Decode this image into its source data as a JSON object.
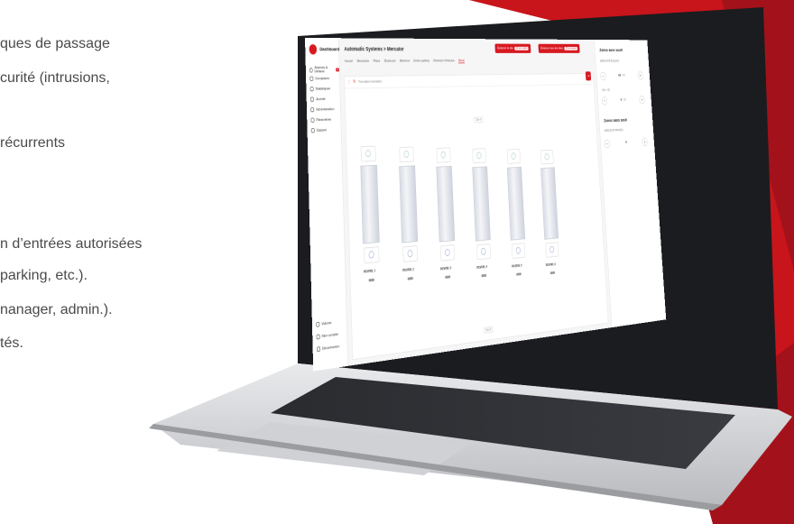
{
  "left_text": {
    "lines": [
      "ques de passage",
      "curité  (intrusions,",
      " récurrents",
      "n d’entrées autorisées",
      " parking, etc.).",
      "nanager, admin.).",
      "tés."
    ]
  },
  "colors": {
    "brand": "#d71920",
    "accent_dark": "#a3121a"
  },
  "app": {
    "sidebar": {
      "title": "Dashboard",
      "items": [
        {
          "label": "Alarmes & Défauts",
          "badge": "3",
          "icon": "bell-icon"
        },
        {
          "label": "Compteurs",
          "icon": "counter-icon"
        },
        {
          "label": "Statistiques",
          "icon": "chart-icon"
        },
        {
          "label": "Journal",
          "icon": "journal-icon"
        },
        {
          "label": "Administration",
          "icon": "admin-icon"
        },
        {
          "label": "Paramètres",
          "icon": "gear-icon"
        },
        {
          "label": "Support",
          "icon": "support-icon"
        }
      ],
      "bottom": [
        {
          "label": "Volume",
          "icon": "volume-icon"
        },
        {
          "label": "Mon compte",
          "icon": "user-icon"
        },
        {
          "label": "Déconnexion",
          "icon": "logout-icon"
        }
      ]
    },
    "breadcrumb": "Automatic Systems > Mercator",
    "tabs": [
      "Accueil",
      "Mezzanine",
      "Pistes",
      "Showroom",
      "Barrières",
      "Entrée parking",
      "Showroom FirstLane",
      "Démo"
    ],
    "active_tab": "Démo",
    "actions": [
      {
        "label": "Évacuer le site",
        "count": "10 en cours"
      },
      {
        "label": "Évacuer tous les sites",
        "count": "10 en cours"
      }
    ],
    "panel": {
      "toolbar_label": "Formulaire l'orientation",
      "zone_top": "Side A",
      "zone_bottom": "Side B",
      "gates": [
        "PGVF80_1",
        "PGVF80_2",
        "PGVF80_3",
        "PGVF80_4",
        "PGVF80_5",
        "PGVF80_6"
      ]
    },
    "right_panel": {
      "title_with": "Zones avec seuil",
      "zones_with": [
        {
          "name": "MERCATOR BUILDING",
          "value": "63",
          "max": "/ 500"
        },
        {
          "name": "ASA - HQ",
          "value": "0",
          "max": "/ 100"
        }
      ],
      "title_without": "Zones sans seuil",
      "zones_without": [
        {
          "name": "MERCATOR PARKING",
          "value": "0"
        }
      ]
    }
  }
}
